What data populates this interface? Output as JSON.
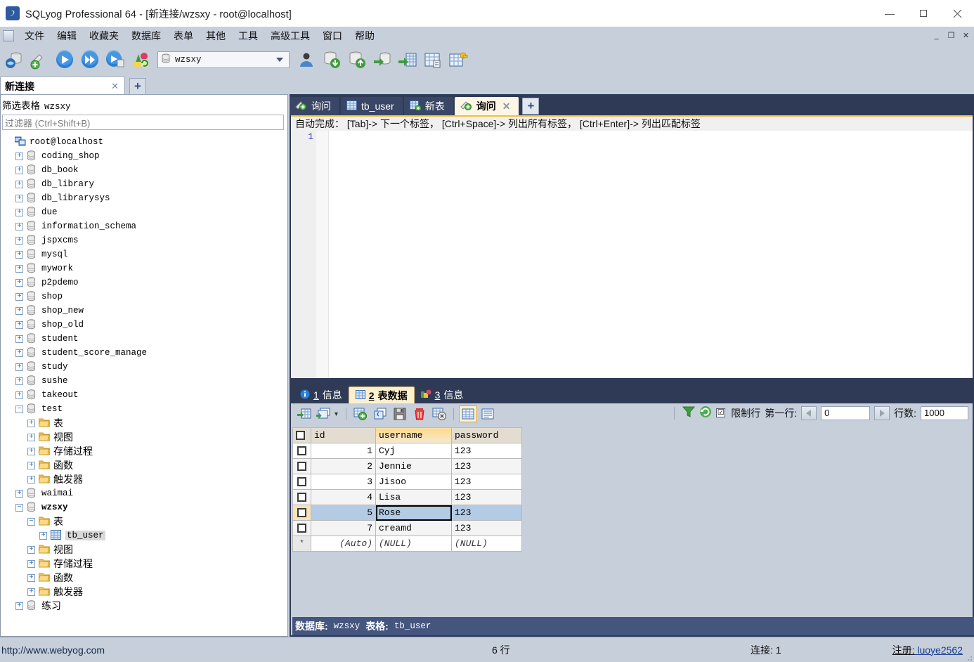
{
  "window": {
    "app_icon": "sqlyog-icon",
    "title": "SQLyog Professional 64 - [新连接/wzsxy - root@localhost]",
    "minimize": "—",
    "maximize": "▫",
    "close": "✕"
  },
  "mdi_buttons": {
    "minimize": "_",
    "restore": "❐",
    "close": "✕"
  },
  "menubar": {
    "items": [
      {
        "label": "文件",
        "name": "menu-file"
      },
      {
        "label": "编辑",
        "name": "menu-edit"
      },
      {
        "label": "收藏夹",
        "name": "menu-favorites"
      },
      {
        "label": "数据库",
        "name": "menu-database"
      },
      {
        "label": "表单",
        "name": "menu-table"
      },
      {
        "label": "其他",
        "name": "menu-other"
      },
      {
        "label": "工具",
        "name": "menu-tools"
      },
      {
        "label": "高级工具",
        "name": "menu-powertools"
      },
      {
        "label": "窗口",
        "name": "menu-window"
      },
      {
        "label": "帮助",
        "name": "menu-help"
      }
    ]
  },
  "toolbar": {
    "icons": [
      "new-connection-icon",
      "new-query-tab-icon",
      "execute-query-icon",
      "execute-all-queries-icon",
      "execute-query-and-edit-icon",
      "refresh-objects-icon"
    ],
    "db_selector": {
      "value": "wzsxy",
      "icon": "database-icon"
    },
    "right_icons": [
      "user-manager-icon",
      "import-data-icon",
      "export-data-icon",
      "backup-database-icon",
      "export-as-sql-icon",
      "table-diagnostics-icon",
      "schema-designer-icon"
    ]
  },
  "left_panel": {
    "tab": {
      "label": "新连接",
      "close": "✕"
    },
    "add_tab": "+",
    "filter": {
      "title_label": "筛选表格",
      "title_value": "wzsxy",
      "placeholder": "过滤器 (Ctrl+Shift+B)"
    },
    "tree": [
      {
        "label": "root@localhost",
        "indent": 0,
        "toggle": "",
        "icon": "host-icon",
        "kind": "host"
      },
      {
        "label": "coding_shop",
        "indent": 1,
        "toggle": "+",
        "icon": "database-icon",
        "kind": "db"
      },
      {
        "label": "db_book",
        "indent": 1,
        "toggle": "+",
        "icon": "database-icon",
        "kind": "db"
      },
      {
        "label": "db_library",
        "indent": 1,
        "toggle": "+",
        "icon": "database-icon",
        "kind": "db"
      },
      {
        "label": "db_librarysys",
        "indent": 1,
        "toggle": "+",
        "icon": "database-icon",
        "kind": "db"
      },
      {
        "label": "due",
        "indent": 1,
        "toggle": "+",
        "icon": "database-icon",
        "kind": "db"
      },
      {
        "label": "information_schema",
        "indent": 1,
        "toggle": "+",
        "icon": "database-icon",
        "kind": "db"
      },
      {
        "label": "jspxcms",
        "indent": 1,
        "toggle": "+",
        "icon": "database-icon",
        "kind": "db"
      },
      {
        "label": "mysql",
        "indent": 1,
        "toggle": "+",
        "icon": "database-icon",
        "kind": "db"
      },
      {
        "label": "mywork",
        "indent": 1,
        "toggle": "+",
        "icon": "database-icon",
        "kind": "db"
      },
      {
        "label": "p2pdemo",
        "indent": 1,
        "toggle": "+",
        "icon": "database-icon",
        "kind": "db"
      },
      {
        "label": "shop",
        "indent": 1,
        "toggle": "+",
        "icon": "database-icon",
        "kind": "db"
      },
      {
        "label": "shop_new",
        "indent": 1,
        "toggle": "+",
        "icon": "database-icon",
        "kind": "db"
      },
      {
        "label": "shop_old",
        "indent": 1,
        "toggle": "+",
        "icon": "database-icon",
        "kind": "db"
      },
      {
        "label": "student",
        "indent": 1,
        "toggle": "+",
        "icon": "database-icon",
        "kind": "db"
      },
      {
        "label": "student_score_manage",
        "indent": 1,
        "toggle": "+",
        "icon": "database-icon",
        "kind": "db"
      },
      {
        "label": "study",
        "indent": 1,
        "toggle": "+",
        "icon": "database-icon",
        "kind": "db"
      },
      {
        "label": "sushe",
        "indent": 1,
        "toggle": "+",
        "icon": "database-icon",
        "kind": "db"
      },
      {
        "label": "takeout",
        "indent": 1,
        "toggle": "+",
        "icon": "database-icon",
        "kind": "db"
      },
      {
        "label": "test",
        "indent": 1,
        "toggle": "−",
        "icon": "database-icon",
        "kind": "db"
      },
      {
        "label": "表",
        "indent": 2,
        "toggle": "+",
        "icon": "folder-icon",
        "kind": "folder"
      },
      {
        "label": "视图",
        "indent": 2,
        "toggle": "+",
        "icon": "folder-icon",
        "kind": "folder"
      },
      {
        "label": "存储过程",
        "indent": 2,
        "toggle": "+",
        "icon": "folder-icon",
        "kind": "folder"
      },
      {
        "label": "函数",
        "indent": 2,
        "toggle": "+",
        "icon": "folder-icon",
        "kind": "folder"
      },
      {
        "label": "触发器",
        "indent": 2,
        "toggle": "+",
        "icon": "folder-icon",
        "kind": "folder"
      },
      {
        "label": "waimai",
        "indent": 1,
        "toggle": "+",
        "icon": "database-icon",
        "kind": "db"
      },
      {
        "label": "wzsxy",
        "indent": 1,
        "toggle": "−",
        "icon": "database-icon",
        "kind": "db",
        "bold": true
      },
      {
        "label": "表",
        "indent": 2,
        "toggle": "−",
        "icon": "folder-icon",
        "kind": "folder"
      },
      {
        "label": "tb_user",
        "indent": 3,
        "toggle": "+",
        "icon": "table-icon",
        "kind": "table",
        "selected": true
      },
      {
        "label": "视图",
        "indent": 2,
        "toggle": "+",
        "icon": "folder-icon",
        "kind": "folder"
      },
      {
        "label": "存储过程",
        "indent": 2,
        "toggle": "+",
        "icon": "folder-icon",
        "kind": "folder"
      },
      {
        "label": "函数",
        "indent": 2,
        "toggle": "+",
        "icon": "folder-icon",
        "kind": "folder"
      },
      {
        "label": "触发器",
        "indent": 2,
        "toggle": "+",
        "icon": "folder-icon",
        "kind": "folder"
      },
      {
        "label": "练习",
        "indent": 1,
        "toggle": "+",
        "icon": "database-icon",
        "kind": "db"
      }
    ]
  },
  "query_tabs": {
    "tabs": [
      {
        "label": "询问",
        "icon": "query-icon",
        "active": false
      },
      {
        "label": "tb_user",
        "icon": "table-icon",
        "active": false
      },
      {
        "label": "新表",
        "icon": "new-table-icon",
        "active": false
      },
      {
        "label": "询问",
        "icon": "query-icon",
        "active": true,
        "close": "✕"
      }
    ],
    "add_tab": "+"
  },
  "editor": {
    "autocomplete_hint": "自动完成： [Tab]-> 下一个标签， [Ctrl+Space]-> 列出所有标签， [Ctrl+Enter]-> 列出匹配标签",
    "line_numbers": [
      "1"
    ],
    "content": ""
  },
  "results": {
    "tabs": [
      {
        "num": "1",
        "label": "信息",
        "icon": "info-icon",
        "active": false
      },
      {
        "num": "2",
        "label": "表数据",
        "icon": "table-data-icon",
        "active": true
      },
      {
        "num": "3",
        "label": "信息",
        "icon": "objects-info-icon",
        "active": false
      }
    ],
    "toolbar_icons": [
      "refresh-data-icon",
      "refresh-data-dropdown-icon",
      "insert-row-icon",
      "duplicate-row-icon",
      "save-changes-icon",
      "delete-row-icon",
      "discard-changes-icon",
      "grid-view-icon",
      "form-view-icon"
    ],
    "dropdown_caret": "▾",
    "filter_icon": "filter-icon",
    "refresh_icon": "refresh-icon",
    "limit": {
      "checkbox": "☑",
      "checkbox_label": "限制行",
      "first_row_label": "第一行:",
      "first_row_value": "0",
      "prev_arrow": "◀",
      "next_arrow": "▶",
      "count_label": "行数:",
      "count_value": "1000"
    }
  },
  "grid": {
    "columns": [
      "id",
      "username",
      "password"
    ],
    "selected_column": "username",
    "rows": [
      {
        "id": "1",
        "username": "Cyj",
        "password": "123"
      },
      {
        "id": "2",
        "username": "Jennie",
        "password": "123"
      },
      {
        "id": "3",
        "username": "Jisoo",
        "password": "123"
      },
      {
        "id": "4",
        "username": "Lisa",
        "password": "123"
      },
      {
        "id": "5",
        "username": "Rose",
        "password": "123",
        "selected": true,
        "focus_cell": "username"
      },
      {
        "id": "7",
        "username": "creamd",
        "password": "123"
      }
    ],
    "new_row": {
      "marker": "*",
      "id": "(Auto)",
      "username": "(NULL)",
      "password": "(NULL)"
    }
  },
  "db_status": {
    "db_label": "数据库:",
    "db_value": "wzsxy",
    "table_label": "表格:",
    "table_value": "tb_user"
  },
  "statusbar": {
    "url": "http://www.webyog.com",
    "rows": "6 行",
    "connections": "连接: 1",
    "register_label": "注册:",
    "register_user": "luoye2562"
  },
  "colors": {
    "chrome": "#c7cfdb",
    "panel_dark": "#2e3a56",
    "status_dark": "#44557e",
    "accent_yellow": "#f0c040",
    "selection_blue": "#b4cbe6",
    "link": "#1b3d8f"
  }
}
